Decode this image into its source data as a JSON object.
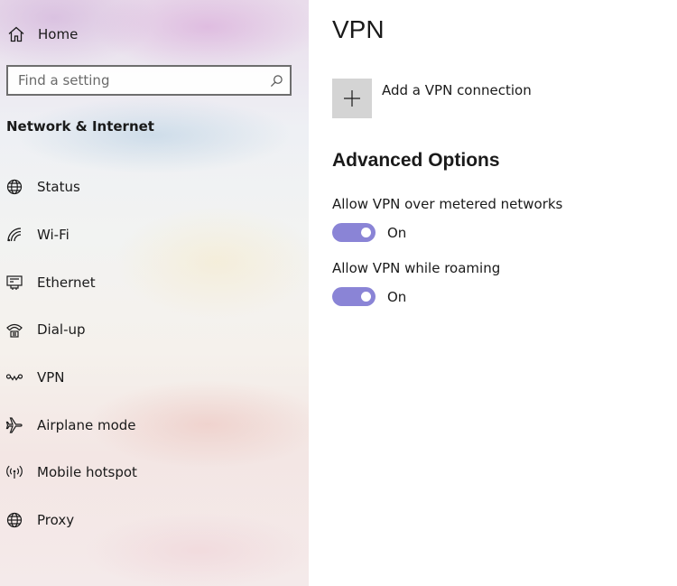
{
  "sidebar": {
    "home_label": "Home",
    "search_placeholder": "Find a setting",
    "section_title": "Network & Internet",
    "items": [
      {
        "label": "Status",
        "icon": "globe-icon"
      },
      {
        "label": "Wi-Fi",
        "icon": "wifi-icon"
      },
      {
        "label": "Ethernet",
        "icon": "ethernet-icon"
      },
      {
        "label": "Dial-up",
        "icon": "dialup-icon"
      },
      {
        "label": "VPN",
        "icon": "vpn-icon"
      },
      {
        "label": "Airplane mode",
        "icon": "airplane-icon"
      },
      {
        "label": "Mobile hotspot",
        "icon": "hotspot-icon"
      },
      {
        "label": "Proxy",
        "icon": "globe-icon"
      }
    ]
  },
  "main": {
    "title": "VPN",
    "add_connection_label": "Add a VPN connection",
    "advanced_heading": "Advanced Options",
    "options": [
      {
        "label": "Allow VPN over metered networks",
        "state": "On",
        "on": true
      },
      {
        "label": "Allow VPN while roaming",
        "state": "On",
        "on": true
      }
    ]
  },
  "colors": {
    "toggle_on": "#8a84d6",
    "add_tile": "#d4d4d4",
    "search_border": "#6e6e6e"
  }
}
